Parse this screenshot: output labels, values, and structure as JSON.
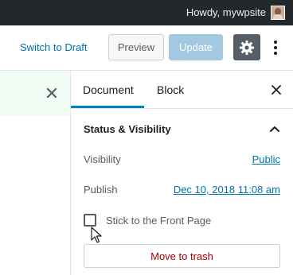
{
  "admin_bar": {
    "greeting": "Howdy, mywpsite",
    "avatar_icon": "user-avatar"
  },
  "header": {
    "switch_to_draft": "Switch to Draft",
    "preview": "Preview",
    "update": "Update",
    "settings_icon": "gear-icon",
    "more_icon": "more-vertical-icon"
  },
  "sidebar": {
    "tabs": [
      {
        "label": "Document",
        "active": true
      },
      {
        "label": "Block",
        "active": false
      }
    ],
    "close_icon": "close-icon",
    "panel": {
      "title": "Status & Visibility",
      "expanded": true,
      "visibility_label": "Visibility",
      "visibility_value": "Public",
      "publish_label": "Publish",
      "publish_value": "Dec 10, 2018 11:08 am",
      "sticky_label": "Stick to the Front Page",
      "sticky_checked": false,
      "trash_label": "Move to trash"
    }
  },
  "colors": {
    "accent": "#0085ba",
    "link": "#0073aa",
    "update_disabled": "#a3c9e1",
    "trash_text": "#aa0000",
    "admin_bar_bg": "#23282d"
  }
}
